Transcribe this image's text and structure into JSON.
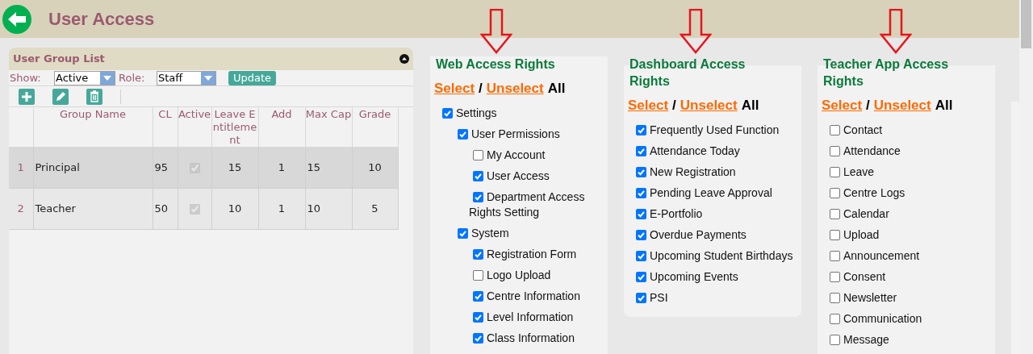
{
  "header": {
    "title": "User Access"
  },
  "group_panel": {
    "title": "User Group List",
    "show_label": "Show:",
    "show_value": "Active",
    "role_label": "Role:",
    "role_value": "Staff",
    "update_button": "Update",
    "table": {
      "columns": [
        "Group Name",
        "CL",
        "Active",
        "Leave Entitlement",
        "Add",
        "Max Cap",
        "Grade"
      ],
      "rows": [
        {
          "index": "1",
          "name": "Principal",
          "cl": "95",
          "active": true,
          "leave": "15",
          "add": "1",
          "max_cap": "15",
          "grade": "10",
          "selected": true
        },
        {
          "index": "2",
          "name": "Teacher",
          "cl": "50",
          "active": true,
          "leave": "10",
          "add": "1",
          "max_cap": "10",
          "grade": "5",
          "selected": false
        }
      ]
    }
  },
  "rights_panels": [
    {
      "title": "Web Access Rights",
      "select": "Select",
      "separator": "/",
      "unselect": "Unselect",
      "all": "All",
      "items": [
        {
          "label": "Settings",
          "checked": true,
          "children": [
            {
              "label": "User Permissions",
              "checked": true,
              "children": [
                {
                  "label": "My Account",
                  "checked": false
                },
                {
                  "label": "User Access",
                  "checked": true
                },
                {
                  "label": "Department Access Rights Setting",
                  "checked": true
                }
              ]
            },
            {
              "label": "System",
              "checked": true,
              "children": [
                {
                  "label": "Registration Form",
                  "checked": true
                },
                {
                  "label": "Logo Upload",
                  "checked": false
                },
                {
                  "label": "Centre Information",
                  "checked": true
                },
                {
                  "label": "Level Information",
                  "checked": true
                },
                {
                  "label": "Class Information",
                  "checked": true
                }
              ]
            }
          ]
        }
      ]
    },
    {
      "title": "Dashboard Access Rights",
      "select": "Select",
      "separator": "/",
      "unselect": "Unselect",
      "all": "All",
      "items": [
        {
          "label": "Frequently Used Function",
          "checked": true
        },
        {
          "label": "Attendance Today",
          "checked": true
        },
        {
          "label": "New Registration",
          "checked": true
        },
        {
          "label": "Pending Leave Approval",
          "checked": true
        },
        {
          "label": "E-Portfolio",
          "checked": true
        },
        {
          "label": "Overdue Payments",
          "checked": true
        },
        {
          "label": "Upcoming Student Birthdays",
          "checked": true
        },
        {
          "label": "Upcoming Events",
          "checked": true
        },
        {
          "label": "PSI",
          "checked": true
        }
      ]
    },
    {
      "title": "Teacher App Access Rights",
      "select": "Select",
      "separator": "/",
      "unselect": "Unselect",
      "all": "All",
      "items": [
        {
          "label": "Contact",
          "checked": false
        },
        {
          "label": "Attendance",
          "checked": false
        },
        {
          "label": "Leave",
          "checked": false
        },
        {
          "label": "Centre Logs",
          "checked": false
        },
        {
          "label": "Calendar",
          "checked": false
        },
        {
          "label": "Upload",
          "checked": false
        },
        {
          "label": "Announcement",
          "checked": false
        },
        {
          "label": "Consent",
          "checked": false
        },
        {
          "label": "Newsletter",
          "checked": false
        },
        {
          "label": "Communication",
          "checked": false
        },
        {
          "label": "Message",
          "checked": false
        }
      ]
    }
  ]
}
